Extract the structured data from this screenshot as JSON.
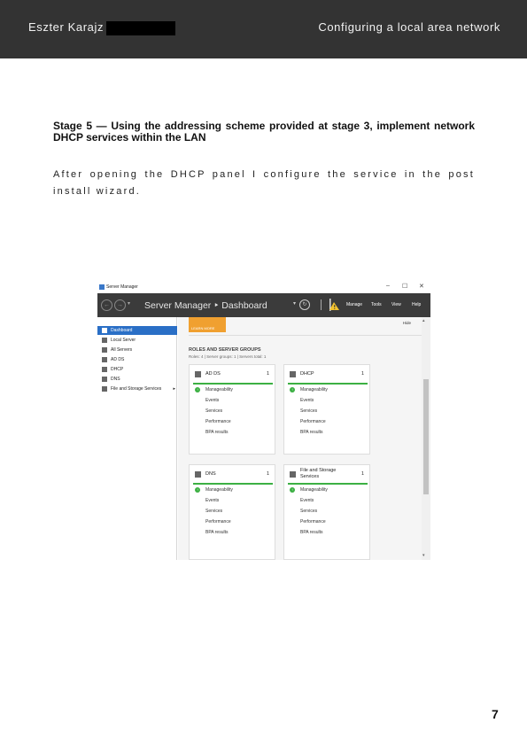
{
  "header": {
    "author": "Eszter Karajz",
    "title": "Configuring a local area network"
  },
  "content": {
    "stage_heading": "Stage 5 — Using the addressing scheme provided at stage 3, implement network DHCP services within the LAN",
    "paragraph": "After opening the DHCP panel I configure the service in the post install wizard."
  },
  "screenshot": {
    "window_title": "Server Manager",
    "window_controls": [
      "–",
      "☐",
      "✕"
    ],
    "breadcrumb": "Server Manager ‣ Dashboard",
    "toolbar_menu": [
      "Manage",
      "Tools",
      "View",
      "Help"
    ],
    "sidebar_items": [
      {
        "label": "Dashboard",
        "active": true
      },
      {
        "label": "Local Server"
      },
      {
        "label": "All Servers"
      },
      {
        "label": "AD DS"
      },
      {
        "label": "DHCP"
      },
      {
        "label": "DNS"
      },
      {
        "label": "File and Storage Services"
      }
    ],
    "learn_more": "LEARN MORE",
    "hide_label": "Hide",
    "roles_heading": "ROLES AND SERVER GROUPS",
    "roles_sub": "Roles: 4  |  Server groups: 1  |  Servers total: 1",
    "tiles": [
      {
        "name": "AD DS",
        "count": "1",
        "rows": [
          "Manageability",
          "Events",
          "Services",
          "Performance",
          "BPA results"
        ]
      },
      {
        "name": "DHCP",
        "count": "1",
        "rows": [
          "Manageability",
          "Events",
          "Services",
          "Performance",
          "BPA results"
        ]
      },
      {
        "name": "DNS",
        "count": "1",
        "rows": [
          "Manageability",
          "Events",
          "Services",
          "Performance",
          "BPA results"
        ]
      },
      {
        "name": "File and Storage Services",
        "count": "1",
        "rows": [
          "Manageability",
          "Events",
          "Services",
          "Performance",
          "BPA results"
        ]
      }
    ],
    "status_color": "#3cb043",
    "toolbar_color": "#3b3b3b",
    "accent_color": "#2a6fc6"
  },
  "page_number": "7"
}
